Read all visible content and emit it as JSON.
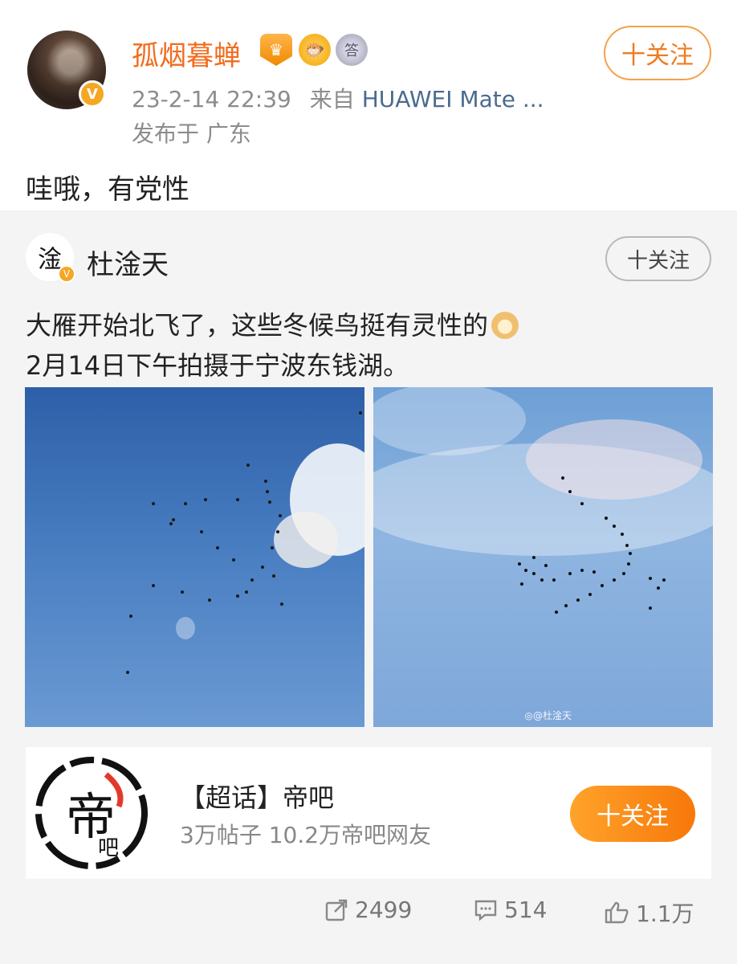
{
  "post": {
    "username": "孤烟暮蝉",
    "timestamp": "23-2-14 22:39",
    "source_prefix": "来自",
    "source": "HUAWEI Mate ...",
    "location": "发布于 广东",
    "follow_label": "十关注",
    "text": "哇哦，有党性",
    "avatar_badge": "V",
    "badge_medal_text": "答"
  },
  "repost": {
    "username": "杜淦天",
    "avatar_glyph": "淦",
    "avatar_badge": "V",
    "follow_label": "十关注",
    "text_line1": "大雁开始北飞了，这些冬候鸟挺有灵性的",
    "text_line2": "2月14日下午拍摄于宁波东钱湖。",
    "watermark": "◎@杜淦天"
  },
  "topic_card": {
    "title": "【超话】帝吧",
    "subtitle": "3万帖子 10.2万帝吧网友",
    "follow_label": "十关注",
    "logo_text": "帝",
    "logo_sub": "吧"
  },
  "actions": {
    "share_count": "2499",
    "comment_count": "514",
    "like_count": "1.1万"
  },
  "colors": {
    "username": "#f26b1d",
    "follow_border": "#f6a04b",
    "follow_card_bg": "#f7780a",
    "source_link": "#4a6b8f"
  },
  "icons": {
    "share": "share-icon",
    "comment": "comment-icon",
    "like": "thumbs-up-icon"
  }
}
